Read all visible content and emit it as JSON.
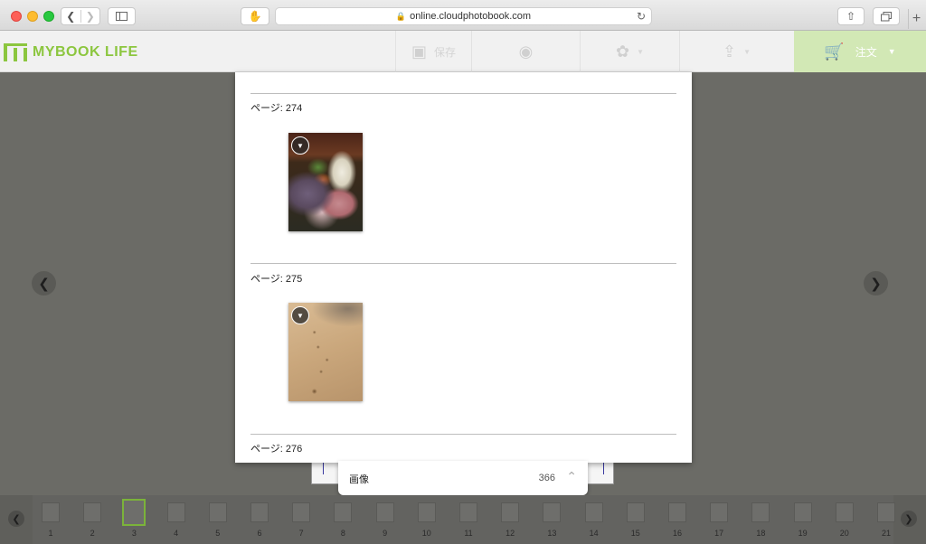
{
  "browser": {
    "url": "online.cloudphotobook.com"
  },
  "app": {
    "logo_text": "MYBOOK LIFE",
    "toolbar": {
      "save_label": "保存",
      "order_label": "注文"
    }
  },
  "panel": {
    "sections": [
      {
        "label": "ページ: 274",
        "photo": "food-photo"
      },
      {
        "label": "ページ: 275",
        "photo": "sand-footprints-photo"
      },
      {
        "label": "ページ: 276"
      }
    ]
  },
  "tray": {
    "label": "画像",
    "count": "366"
  },
  "strip": {
    "active_page": "3",
    "pages": [
      "1",
      "2",
      "3",
      "4",
      "5",
      "6",
      "7",
      "8",
      "9",
      "10",
      "11",
      "12",
      "13",
      "14",
      "15",
      "16",
      "17",
      "18",
      "19",
      "20",
      "21"
    ]
  },
  "colors": {
    "brand_green": "#8cc63f",
    "order_bg": "#d2e8b5",
    "active_thumb": "#7bb33a"
  }
}
